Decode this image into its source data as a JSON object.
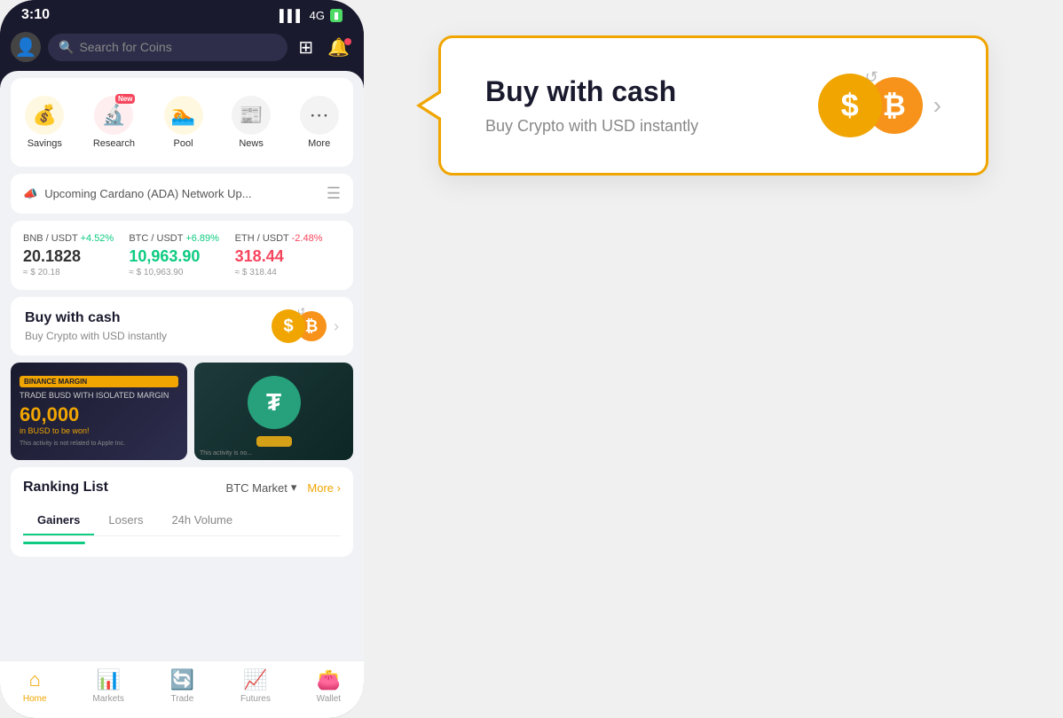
{
  "status_bar": {
    "time": "3:10",
    "signal": "4G",
    "battery": "🔋"
  },
  "search": {
    "placeholder": "Search for Coins"
  },
  "quick_actions": [
    {
      "id": "savings",
      "label": "Savings",
      "icon": "💰",
      "icon_class": "icon-savings",
      "new_badge": false
    },
    {
      "id": "research",
      "label": "Research",
      "icon": "🔍",
      "icon_class": "icon-research",
      "new_badge": true
    },
    {
      "id": "pool",
      "label": "Pool",
      "icon": "🏊",
      "icon_class": "icon-pool",
      "new_badge": false
    },
    {
      "id": "news",
      "label": "News",
      "icon": "📰",
      "icon_class": "icon-news",
      "new_badge": false
    },
    {
      "id": "more",
      "label": "More",
      "icon": "⋯",
      "icon_class": "icon-more",
      "new_badge": false
    }
  ],
  "new_badge_label": "New",
  "announcement": {
    "text": "Upcoming Cardano (ADA) Network Up...",
    "icon": "📣"
  },
  "tickers": [
    {
      "pair": "BNB / USDT",
      "change": "+4.52%",
      "change_type": "pos",
      "price": "20.1828",
      "usd": "≈ $ 20.18"
    },
    {
      "pair": "BTC / USDT",
      "change": "+6.89%",
      "change_type": "pos",
      "price": "10,963.90",
      "usd": "≈ $ 10,963.90"
    },
    {
      "pair": "ETH / USDT",
      "change": "-2.48%",
      "change_type": "neg",
      "price": "318.44",
      "usd": "≈ $ 318.44"
    }
  ],
  "buy_cash": {
    "title": "Buy with cash",
    "subtitle": "Buy Crypto with USD instantly"
  },
  "banners": [
    {
      "type": "dark",
      "badge": "BINANCE MARGIN",
      "tagline": "TRADE BUSD WITH ISOLATED MARGIN",
      "amount": "60,000",
      "currency": "in BUSD to be won!",
      "disclaimer": "This activity is not related to Apple Inc."
    },
    {
      "type": "tether",
      "disclaimer": "This activity is no..."
    }
  ],
  "ranking": {
    "title": "Ranking List",
    "market": "BTC Market",
    "more": "More",
    "tabs": [
      {
        "id": "gainers",
        "label": "Gainers",
        "active": true
      },
      {
        "id": "losers",
        "label": "Losers",
        "active": false
      },
      {
        "id": "volume",
        "label": "24h Volume",
        "active": false
      }
    ]
  },
  "bottom_nav": [
    {
      "id": "home",
      "label": "Home",
      "icon": "🏠",
      "active": true
    },
    {
      "id": "markets",
      "label": "Markets",
      "icon": "📊",
      "active": false
    },
    {
      "id": "trade",
      "label": "Trade",
      "icon": "🔄",
      "active": false
    },
    {
      "id": "futures",
      "label": "Futures",
      "icon": "📈",
      "active": false
    },
    {
      "id": "wallet",
      "label": "Wallet",
      "icon": "👛",
      "active": false
    }
  ],
  "popup": {
    "title": "Buy with cash",
    "subtitle": "Buy Crypto with USD instantly"
  }
}
